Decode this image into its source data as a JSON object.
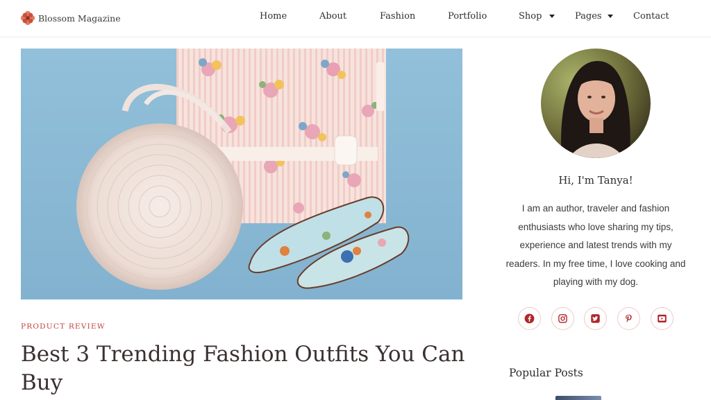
{
  "header": {
    "logo_text": "Blossom Magazine",
    "nav": {
      "home": "Home",
      "about": "About",
      "fashion": "Fashion",
      "portfolio": "Portfolio",
      "shop": "Shop",
      "pages": "Pages",
      "contact": "Contact"
    }
  },
  "post": {
    "category": "PRODUCT REVIEW",
    "title": "Best 3 Trending Fashion Outfits You Can Buy"
  },
  "sidebar": {
    "greeting": "Hi, I'm Tanya!",
    "bio": "I am an author, traveler and fashion enthusiasts who love sharing my tips, experience and latest trends with my readers. In my free time, I love cooking and playing with my dog.",
    "social": [
      "facebook-icon",
      "instagram-icon",
      "twitter-icon",
      "pinterest-icon",
      "youtube-icon"
    ],
    "popular_heading": "Popular Posts"
  },
  "colors": {
    "accent": "#c1443f",
    "icon": "#b2252b",
    "hero_background": "#8fbcd6"
  }
}
